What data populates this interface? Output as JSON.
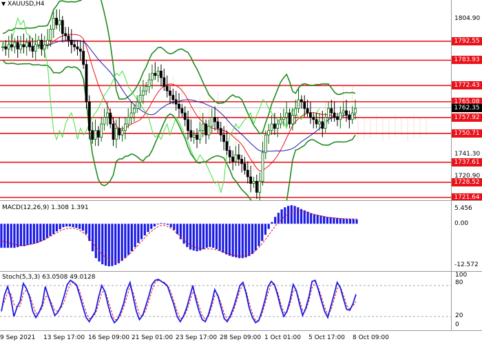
{
  "chart_title": "XAUUSD,H4",
  "price_axis": {
    "ticks": [
      "1804.90",
      "1741.30",
      "1720.90"
    ],
    "level_tags": [
      "1792.55",
      "1783.93",
      "1772.43",
      "1765.08",
      "1757.92",
      "1750.71",
      "1737.61",
      "1728.52",
      "1721.64"
    ],
    "current_price": "1762.35"
  },
  "macd": {
    "label": "MACD(12,26,9) 1.308 1.391",
    "ticks": [
      "5.456",
      "0.00",
      "-12.572"
    ]
  },
  "stoch": {
    "label": "Stoch(5,3,3) 63.0508 49.0128",
    "ticks": [
      "100",
      "80",
      "20",
      "0"
    ]
  },
  "time_axis": [
    "9 Sep 2021",
    "13 Sep 17:00",
    "16 Sep 09:00",
    "21 Sep 01:00",
    "23 Sep 17:00",
    "28 Sep 09:00",
    "1 Oct 01:00",
    "5 Oct 17:00",
    "8 Oct 09:00"
  ],
  "colors": {
    "level_line": "#e8121a",
    "bull_candle": "#006400",
    "bear_candle": "#000000",
    "bollinger": "#1e8a1e",
    "ma_red": "#e8121a",
    "ma_blue": "#1a1ab0",
    "ma_green_light": "#3fe03f",
    "cloud": "#f4a07a",
    "macd_hist": "#1a1ae6",
    "macd_signal": "#e8121a",
    "stoch_main": "#1a1ae6",
    "stoch_signal": "#e8121a"
  },
  "chart_data": {
    "type": "candlestick",
    "symbol": "XAUUSD",
    "timeframe": "H4",
    "ylim": [
      1721.64,
      1810
    ],
    "horizontal_levels": [
      1792.55,
      1783.93,
      1772.43,
      1765.08,
      1757.92,
      1750.71,
      1737.61,
      1728.52,
      1721.64
    ],
    "current_price": 1762.35,
    "close_series": [
      1790,
      1789,
      1791,
      1790,
      1792,
      1789,
      1791,
      1790,
      1792,
      1790,
      1788,
      1791,
      1793,
      1789,
      1791,
      1793,
      1798,
      1803,
      1800,
      1802,
      1796,
      1795,
      1793,
      1791,
      1790,
      1789,
      1788,
      1782,
      1765,
      1752,
      1748,
      1752,
      1749,
      1755,
      1758,
      1760,
      1755,
      1748,
      1753,
      1750,
      1752,
      1755,
      1758,
      1760,
      1762,
      1765,
      1768,
      1770,
      1772,
      1775,
      1778,
      1777,
      1779,
      1776,
      1772,
      1770,
      1768,
      1766,
      1764,
      1762,
      1760,
      1757,
      1752,
      1749,
      1750,
      1748,
      1752,
      1755,
      1750,
      1754,
      1758,
      1756,
      1753,
      1750,
      1747,
      1743,
      1740,
      1738,
      1741,
      1739,
      1737,
      1734,
      1731,
      1728,
      1729,
      1724,
      1729,
      1742,
      1750,
      1752,
      1755,
      1753,
      1755,
      1757,
      1758,
      1760,
      1755,
      1759,
      1762,
      1766,
      1765,
      1762,
      1760,
      1758,
      1757,
      1755,
      1756,
      1753,
      1758,
      1762,
      1760,
      1758,
      1757,
      1760,
      1761,
      1759,
      1757,
      1760,
      1762
    ],
    "macd": {
      "ylim": [
        -12.572,
        5.456
      ],
      "histogram": [
        -7,
        -7,
        -7,
        -7,
        -7,
        -6.8,
        -6.5,
        -6.5,
        -6.2,
        -6,
        -5.8,
        -5.6,
        -5.2,
        -4.8,
        -4.2,
        -3.6,
        -3,
        -2.2,
        -1.6,
        -1,
        -0.8,
        -0.8,
        -1,
        -1.2,
        -1.5,
        -2,
        -3,
        -5,
        -8,
        -10,
        -11,
        -11.8,
        -12.2,
        -12.4,
        -12.3,
        -12,
        -11.5,
        -10.8,
        -10,
        -9,
        -8,
        -6.8,
        -5.6,
        -4.5,
        -3.4,
        -2.4,
        -1.5,
        -0.8,
        -0.2,
        0.2,
        0.1,
        -0.3,
        -1,
        -1.8,
        -3,
        -4.5,
        -5.8,
        -6.8,
        -7.5,
        -7.8,
        -8,
        -7.8,
        -7.4,
        -7,
        -6.8,
        -7,
        -7.4,
        -7.9,
        -8.4,
        -8.9,
        -9.3,
        -9.6,
        -9.8,
        -10,
        -10,
        -9.8,
        -9.4,
        -8.8,
        -7.8,
        -6.5,
        -5,
        -3.2,
        -1.5,
        0.5,
        2,
        3.2,
        4.2,
        4.8,
        5.2,
        5.4,
        5.2,
        4.8,
        4.3,
        3.9,
        3.5,
        3.1,
        2.8,
        2.6,
        2.4,
        2.2,
        2,
        1.9,
        1.8,
        1.7,
        1.6,
        1.5,
        1.45,
        1.4,
        1.35,
        1.3
      ],
      "signal": [
        -5,
        -5.2,
        -5.5,
        -5.7,
        -6,
        -6.2,
        -6.3,
        -6.3,
        -6.2,
        -6,
        -5.8,
        -5.5,
        -5.1,
        -4.7,
        -4.2,
        -3.7,
        -3.1,
        -2.6,
        -2.1,
        -1.7,
        -1.4,
        -1.3,
        -1.3,
        -1.5,
        -1.9,
        -2.5,
        -3.3,
        -4.3,
        -5.5,
        -6.8,
        -8,
        -9,
        -9.8,
        -10.4,
        -10.8,
        -11,
        -10.9,
        -10.5,
        -9.9,
        -9.1,
        -8.2,
        -7.2,
        -6.2,
        -5.1,
        -4.1,
        -3.1,
        -2.2,
        -1.5,
        -0.9,
        -0.5,
        -0.5,
        -0.8,
        -1.3,
        -2,
        -2.9,
        -3.8,
        -4.7,
        -5.5,
        -6.2,
        -6.7,
        -7,
        -7.2,
        -7.3,
        -7.3,
        -7.3,
        -7.4,
        -7.6,
        -7.9,
        -8.2,
        -8.5,
        -8.8,
        -9.1,
        -9.3,
        -9.4,
        -9.4,
        -9.3,
        -9,
        -8.5,
        -7.8,
        -6.9,
        -5.8,
        -4.6,
        -3.3,
        -2,
        -0.7,
        0.4,
        1.4,
        2.2,
        2.9,
        3.4,
        3.7,
        3.8,
        3.7,
        3.5,
        3.3,
        3,
        2.7,
        2.5,
        2.3,
        2.1,
        1.9,
        1.8,
        1.7,
        1.6,
        1.55,
        1.5,
        1.45,
        1.42,
        1.4,
        1.39
      ]
    },
    "stochastic": {
      "ylim": [
        0,
        100
      ],
      "levels": [
        80,
        20
      ],
      "main": [
        30,
        62,
        78,
        56,
        20,
        38,
        50,
        84,
        74,
        58,
        30,
        18,
        28,
        42,
        78,
        58,
        40,
        22,
        28,
        40,
        60,
        82,
        90,
        86,
        80,
        60,
        38,
        18,
        10,
        20,
        30,
        58,
        80,
        68,
        42,
        20,
        8,
        14,
        28,
        46,
        72,
        86,
        58,
        30,
        14,
        22,
        40,
        60,
        82,
        90,
        92,
        88,
        84,
        78,
        60,
        42,
        20,
        10,
        20,
        36,
        58,
        80,
        52,
        30,
        14,
        10,
        24,
        46,
        72,
        60,
        38,
        16,
        10,
        22,
        38,
        58,
        80,
        86,
        64,
        36,
        18,
        8,
        12,
        30,
        52,
        78,
        88,
        82,
        62,
        38,
        20,
        30,
        52,
        82,
        70,
        44,
        22,
        36,
        58,
        88,
        90,
        72,
        50,
        30,
        18,
        40,
        62,
        86,
        76,
        54,
        34,
        32,
        44,
        63
      ],
      "signal": [
        34,
        50,
        66,
        64,
        44,
        38,
        40,
        64,
        72,
        62,
        44,
        26,
        28,
        36,
        58,
        60,
        46,
        32,
        30,
        36,
        48,
        68,
        84,
        86,
        82,
        68,
        48,
        28,
        16,
        18,
        26,
        44,
        66,
        70,
        52,
        32,
        14,
        14,
        22,
        38,
        58,
        78,
        68,
        44,
        24,
        20,
        32,
        50,
        70,
        86,
        90,
        88,
        86,
        80,
        68,
        50,
        30,
        16,
        18,
        30,
        48,
        68,
        60,
        40,
        22,
        14,
        20,
        38,
        60,
        62,
        46,
        26,
        14,
        18,
        32,
        50,
        70,
        82,
        70,
        46,
        26,
        12,
        12,
        24,
        44,
        66,
        82,
        82,
        68,
        46,
        28,
        28,
        44,
        70,
        70,
        52,
        32,
        32,
        50,
        76,
        86,
        76,
        58,
        38,
        24,
        32,
        52,
        74,
        78,
        62,
        42,
        34,
        40,
        49
      ]
    }
  }
}
